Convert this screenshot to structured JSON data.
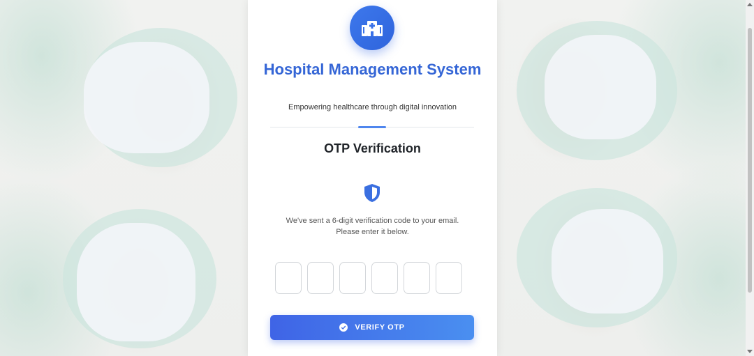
{
  "app": {
    "title": "Hospital Management System",
    "tagline": "Empowering healthcare through digital innovation"
  },
  "otp": {
    "heading": "OTP Verification",
    "info_line1": "We've sent a 6-digit verification code to your email.",
    "info_line2": "Please enter it below.",
    "digits": [
      "",
      "",
      "",
      "",
      "",
      ""
    ],
    "verify_label": "VERIFY OTP"
  },
  "colors": {
    "accent": "#3566d6",
    "button_start": "#3f64e6",
    "button_end": "#4a8ff0"
  },
  "icons": {
    "logo": "hospital-building-icon",
    "shield": "shield-icon",
    "verify": "check-circle-icon"
  }
}
